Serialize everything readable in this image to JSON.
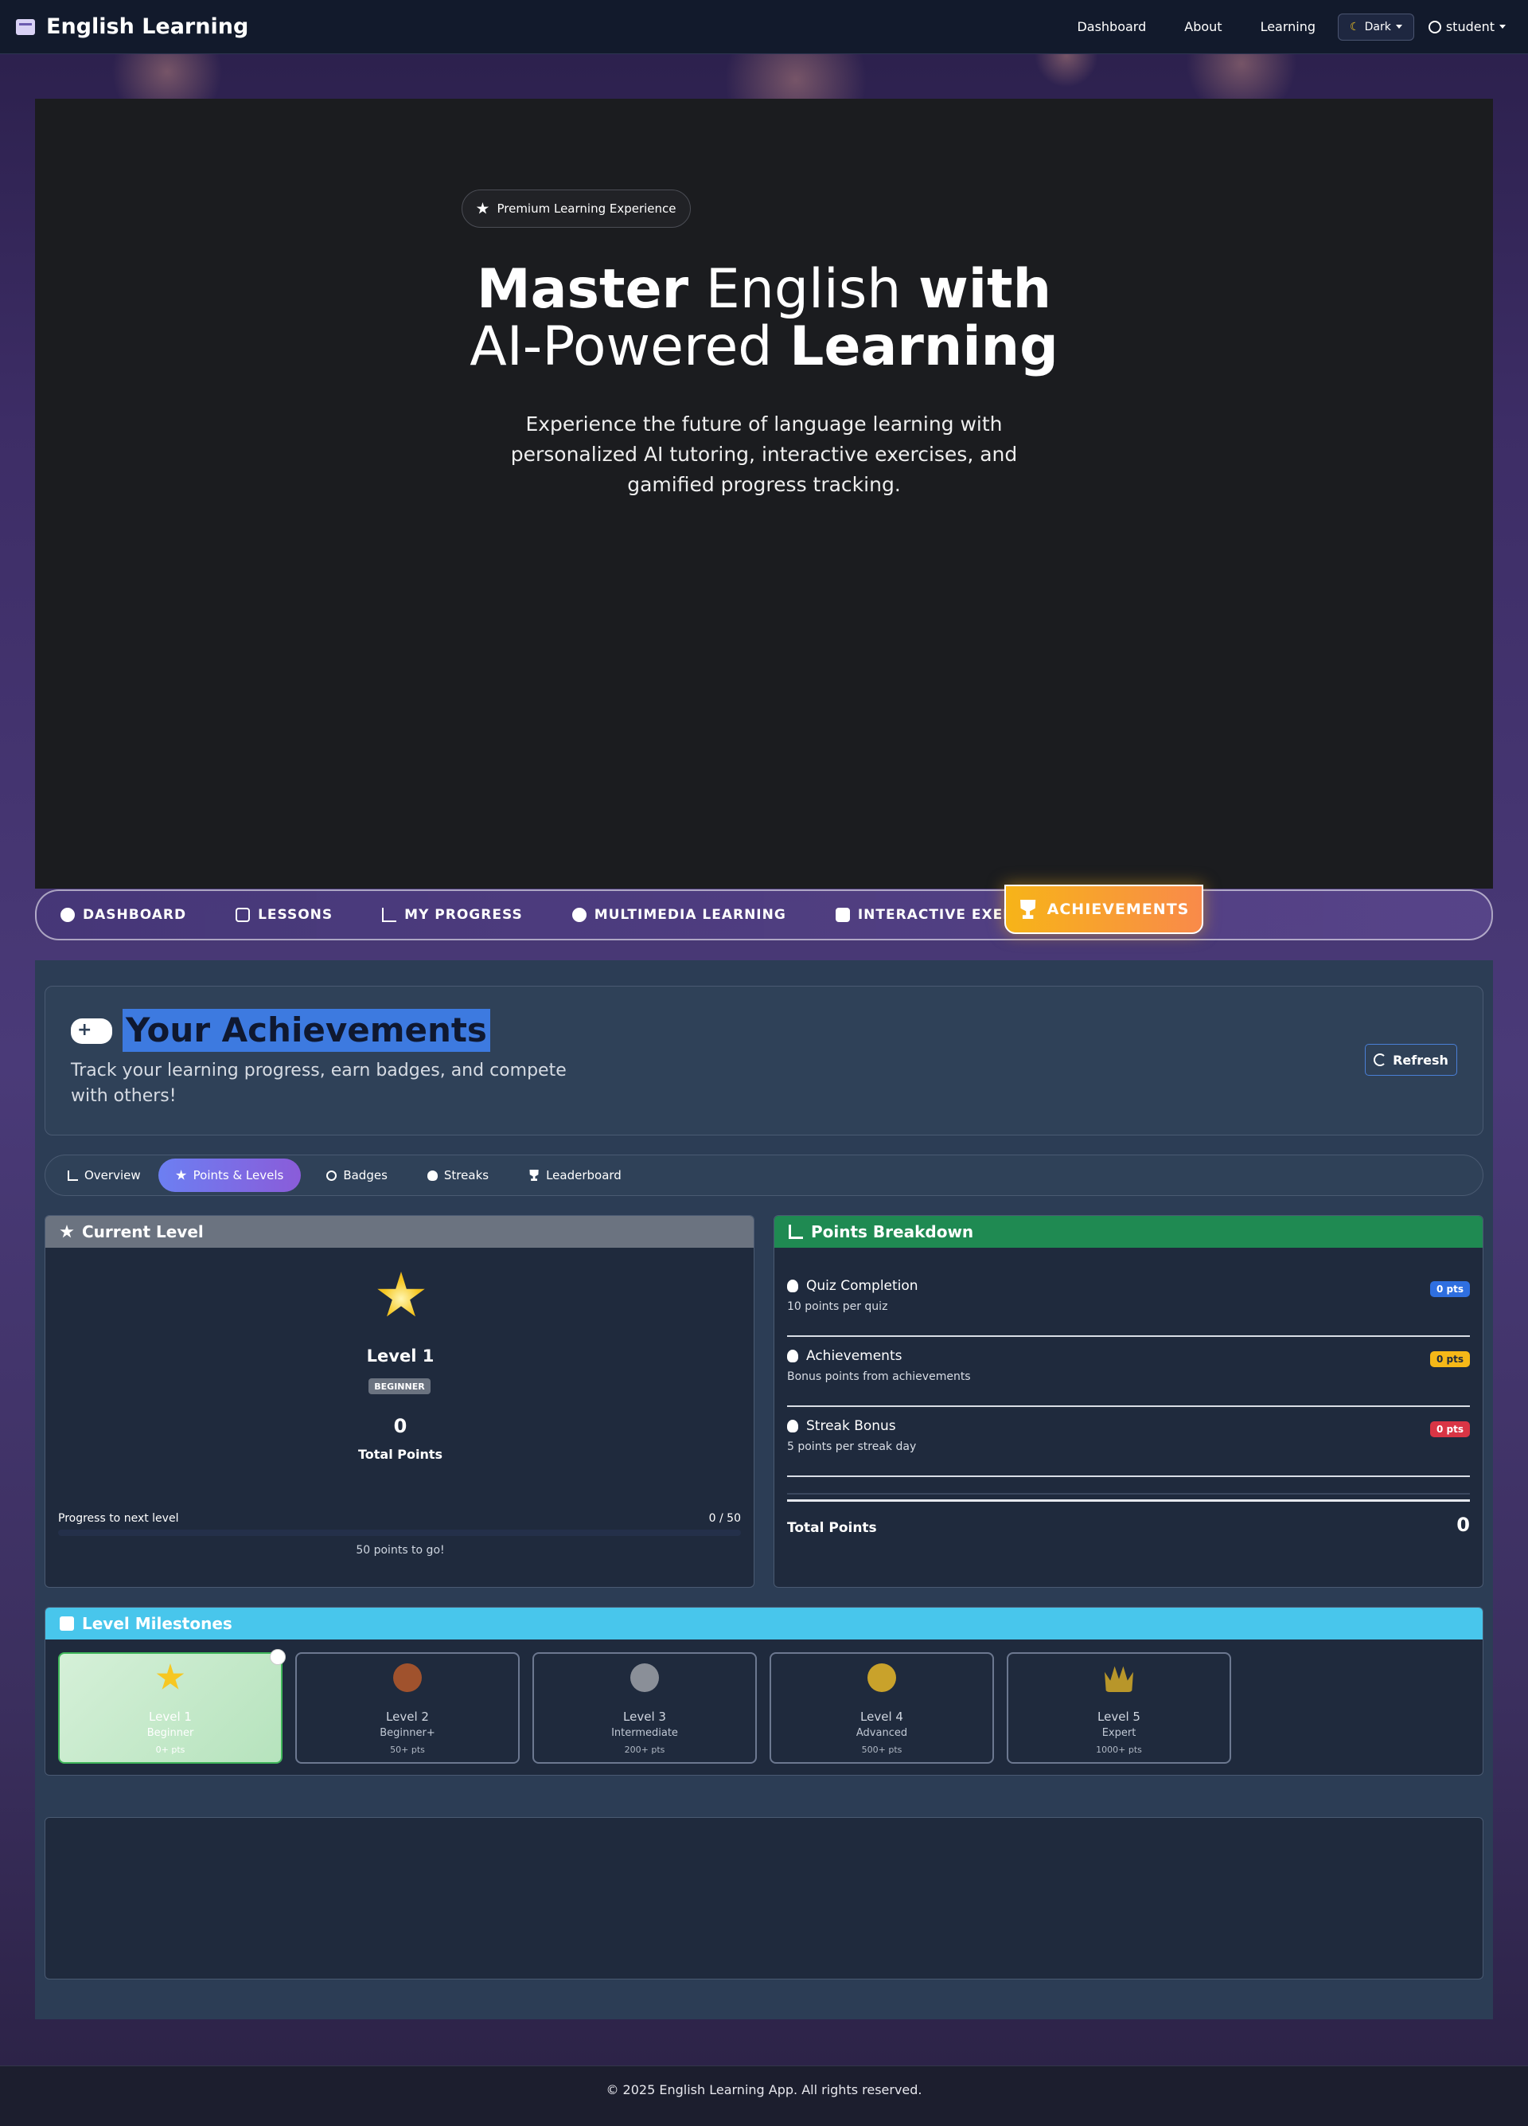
{
  "navbar": {
    "brand": "English Learning",
    "links": [
      "Dashboard",
      "About",
      "Learning"
    ],
    "theme_label": "Dark",
    "user_label": "student"
  },
  "hero": {
    "pill": "Premium Learning Experience",
    "title_line1": [
      "Master",
      " English ",
      "with"
    ],
    "title_line2": [
      "AI-Powered ",
      "Learning"
    ],
    "subtitle": "Experience the future of language learning with personalized AI tutoring, interactive exercises, and gamified progress tracking."
  },
  "tabs": [
    {
      "label": "DASHBOARD",
      "icon": "gauge-icon"
    },
    {
      "label": "LESSONS",
      "icon": "book-icon"
    },
    {
      "label": "MY PROGRESS",
      "icon": "chart-line-icon"
    },
    {
      "label": "MULTIMEDIA LEARNING",
      "icon": "play-circle-icon"
    },
    {
      "label": "INTERACTIVE EXERCISES",
      "icon": "puzzle-icon"
    }
  ],
  "active_tab": {
    "label": "ACHIEVEMENTS",
    "icon": "trophy-icon",
    "color_start": "#f7b418",
    "color_end": "#f98a4a"
  },
  "achievements": {
    "title": "Your Achievements",
    "subtitle": "Track your learning progress, earn badges, and compete with others!",
    "refresh_label": "Refresh"
  },
  "subtabs": [
    {
      "label": "Overview",
      "icon": "chart-line-icon"
    },
    {
      "label": "Points & Levels",
      "icon": "star-icon",
      "active": true
    },
    {
      "label": "Badges",
      "icon": "medal-icon"
    },
    {
      "label": "Streaks",
      "icon": "fire-icon"
    },
    {
      "label": "Leaderboard",
      "icon": "trophy-icon"
    }
  ],
  "current_level": {
    "header": "Current Level",
    "level_name": "Level 1",
    "tier": "BEGINNER",
    "total_points": "0",
    "total_points_label": "Total Points",
    "progress_label": "Progress to next level",
    "progress_value": "0 / 50",
    "progress_fraction": 0,
    "progress_note": "50 points to go!"
  },
  "points_breakdown": {
    "header": "Points Breakdown",
    "rows": [
      {
        "title": "Quiz Completion",
        "desc": "10 points per quiz",
        "badge": "0 pts",
        "color": "#2f6fe0",
        "icon": "brain-icon"
      },
      {
        "title": "Achievements",
        "desc": "Bonus points from achievements",
        "badge": "0 pts",
        "color": "#f5b818",
        "icon": "medal-icon"
      },
      {
        "title": "Streak Bonus",
        "desc": "5 points per streak day",
        "badge": "0 pts",
        "color": "#d93545",
        "icon": "fire-icon"
      }
    ],
    "total_label": "Total Points",
    "total_value": "0"
  },
  "milestones": {
    "header": "Level Milestones",
    "items": [
      {
        "name": "Level 1",
        "tier": "Beginner",
        "pts": "0+ pts",
        "icon": "star-icon",
        "done": true
      },
      {
        "name": "Level 2",
        "tier": "Beginner+",
        "pts": "50+ pts",
        "icon": "bronze-medal-icon",
        "done": false
      },
      {
        "name": "Level 3",
        "tier": "Intermediate",
        "pts": "200+ pts",
        "icon": "silver-medal-icon",
        "done": false
      },
      {
        "name": "Level 4",
        "tier": "Advanced",
        "pts": "500+ pts",
        "icon": "gold-medal-icon",
        "done": false
      },
      {
        "name": "Level 5",
        "tier": "Expert",
        "pts": "1000+ pts",
        "icon": "crown-icon",
        "done": false
      }
    ]
  },
  "footer": "© 2025 English Learning App. All rights reserved."
}
